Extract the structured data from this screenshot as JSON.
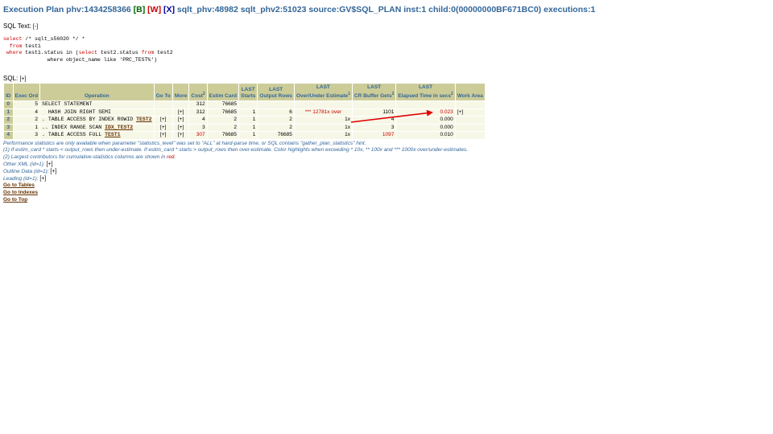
{
  "header": {
    "title_prefix": "Execution Plan  phv:1434258366 ",
    "b": "[B]",
    "w": "[W]",
    "x": "[X]",
    "title_suffix": "  sqlt_phv:48982  sqlt_phv2:51023  source:GV$SQL_PLAN  inst:1  child:0(00000000BF671BC0)  executions:1"
  },
  "sql_text": {
    "label": "SQL Text:",
    "toggle": "[-]",
    "lines": [
      [
        "k:select",
        " /* sqlt_s56020 */ *"
      ],
      [
        "k:  from",
        " test1"
      ],
      [
        "k: where",
        " test1.status in (",
        "k:select",
        " test2.status ",
        "k:from",
        " test2"
      ],
      [
        "",
        "              where object_name like 'PRC_TEST%')"
      ]
    ]
  },
  "sql_section": {
    "label": "SQL:",
    "toggle": "[+]"
  },
  "table": {
    "headers": [
      {
        "top": "",
        "main": "ID",
        "sup": ""
      },
      {
        "top": "",
        "main": "Exec Ord",
        "sup": ""
      },
      {
        "top": "",
        "main": "Operation",
        "sup": ""
      },
      {
        "top": "",
        "main": "Go To",
        "sup": ""
      },
      {
        "top": "",
        "main": "More",
        "sup": ""
      },
      {
        "top": "",
        "main": "Cost",
        "sup": "2"
      },
      {
        "top": "",
        "main": "Estim Card",
        "sup": ""
      },
      {
        "top": "LAST",
        "main": "Starts",
        "sup": ""
      },
      {
        "top": "LAST",
        "main": "Output Rows",
        "sup": ""
      },
      {
        "top": "LAST",
        "main": "Over/Under Estimate",
        "sup": "1"
      },
      {
        "top": "LAST",
        "main": "CR Buffer Gets",
        "sup": "2"
      },
      {
        "top": "LAST",
        "main": "Elapsed Time in secs",
        "sup": "2"
      },
      {
        "top": "",
        "main": "Work Area",
        "sup": ""
      }
    ],
    "rows": [
      {
        "id": "0",
        "ord": "5",
        "op_pre": "SELECT STATEMENT",
        "op_link": "",
        "goto": "",
        "more": "",
        "cost": "312",
        "cost_red": false,
        "card": "76685",
        "starts": "",
        "rows": "",
        "est": "",
        "est_red": false,
        "gets": "",
        "gets_red": false,
        "time": "",
        "time_red": false,
        "work": ""
      },
      {
        "id": "1",
        "ord": "4",
        "op_pre": "  HASH JOIN RIGHT SEMI",
        "op_link": "",
        "goto": "",
        "more": "[+]",
        "cost": "312",
        "cost_red": false,
        "card": "76685",
        "starts": "1",
        "rows": "6",
        "est": "*** 12781x over",
        "est_red": true,
        "gets": "1101",
        "gets_red": false,
        "time": "0.023",
        "time_red": true,
        "work": "[+]"
      },
      {
        "id": "2",
        "ord": "2",
        "op_pre": ". TABLE ACCESS BY INDEX ROWID ",
        "op_link": "TEST2",
        "goto": "[+]",
        "more": "[+]",
        "cost": "4",
        "cost_red": false,
        "card": "2",
        "starts": "1",
        "rows": "2",
        "est": "1x",
        "est_red": false,
        "gets": "4",
        "gets_red": false,
        "time": "0.000",
        "time_red": false,
        "work": ""
      },
      {
        "id": "3",
        "ord": "1",
        "op_pre": ".. INDEX RANGE SCAN ",
        "op_link": "IDX_TEST2",
        "goto": "[+]",
        "more": "[+]",
        "cost": "3",
        "cost_red": false,
        "card": "2",
        "starts": "1",
        "rows": "2",
        "est": "1x",
        "est_red": false,
        "gets": "3",
        "gets_red": false,
        "time": "0.000",
        "time_red": false,
        "work": ""
      },
      {
        "id": "4",
        "ord": "3",
        "op_pre": ". TABLE ACCESS FULL ",
        "op_link": "TEST1",
        "goto": "[+]",
        "more": "[+]",
        "cost": "307",
        "cost_red": true,
        "card": "76685",
        "starts": "1",
        "rows": "76685",
        "est": "1x",
        "est_red": false,
        "gets": "1097",
        "gets_red": true,
        "time": "0.010",
        "time_red": false,
        "work": ""
      }
    ]
  },
  "notes": [
    "Performance statistics are only available when parameter \"statistics_level\" was set to \"ALL\" at hard-parse time, or SQL contains \"gather_plan_statistics\" hint.",
    "(1) If estim_card * starts < output_rows then under-estimate. If estim_card * starts > output_rows then over-estimate. Color highlights when exceeding * 10x, ** 100x and *** 1000x over/under-estimates."
  ],
  "note3": {
    "prefix": "(2) Largest contributors for cumulative-statistics columns are shown in ",
    "red": "red",
    "suffix": "."
  },
  "extras": [
    {
      "label": "Other XML (id=1):",
      "toggle": "[+]"
    },
    {
      "label": "Outline Data (id=1):",
      "toggle": "[+]"
    },
    {
      "label": "Leading (id=1):",
      "toggle": "[+]"
    }
  ],
  "links": [
    "Go to Tables",
    "Go to Indexes",
    "Go to Top"
  ],
  "colors": {
    "header_blue": "#336699",
    "header_bg": "#cccc99",
    "cell_bg": "#f7f7e7",
    "highlight_red": "#cc0000",
    "arrow_red": "#e00000"
  }
}
